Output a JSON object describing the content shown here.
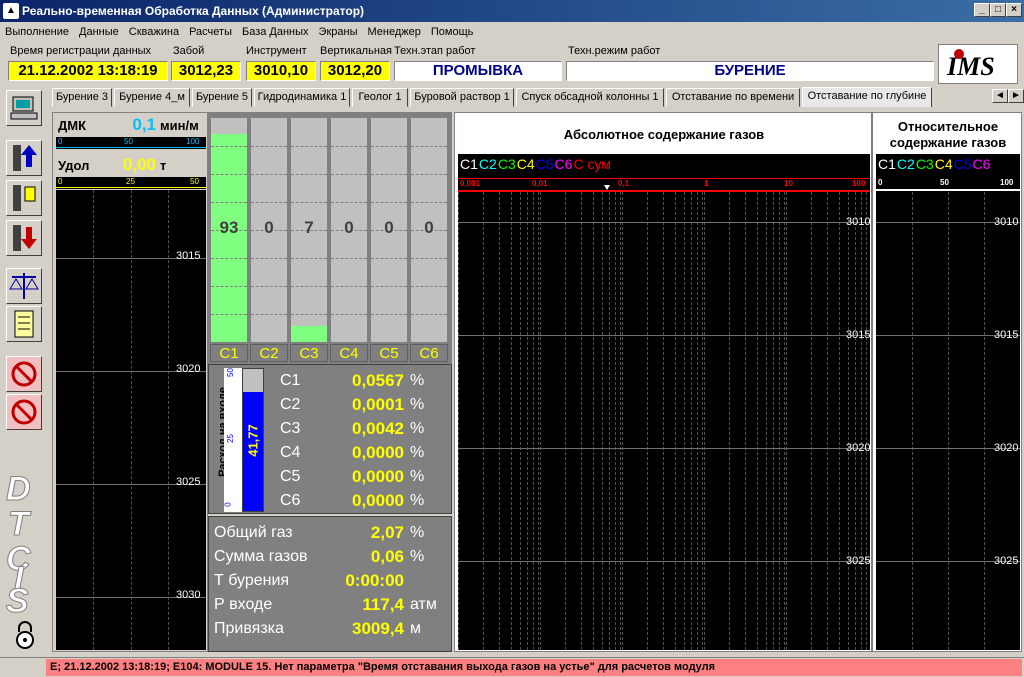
{
  "window": {
    "title": "Реально-временная Обработка Данных (Администратор)"
  },
  "menu": [
    "Выполнение",
    "Данные",
    "Скважина",
    "Расчеты",
    "База Данных",
    "Экраны",
    "Менеджер",
    "Помощь"
  ],
  "header": {
    "reg_time_label": "Время регистрации данных",
    "reg_time_value": "21.12.2002 13:18:19",
    "bottom_label": "Забой",
    "bottom_value": "3012,23",
    "tool_label": "Инструмент",
    "tool_value": "3010,10",
    "vertical_label": "Вертикальная",
    "vertical_value": "3012,20",
    "stage_label": "Техн.этап работ",
    "stage_value": "ПРОМЫВКА",
    "mode_label": "Техн.режим работ",
    "mode_value": "БУРЕНИЕ"
  },
  "tabs": [
    "Бурение 3",
    "Бурение 4_м",
    "Бурение 5",
    "Гидродинамика 1",
    "Геолог 1",
    "Буровой раствор 1",
    "Спуск обсадной колонны 1",
    "Отставание по времени",
    "Отставание по глубине"
  ],
  "active_tab": 8,
  "left_panel": {
    "dmk_label": "ДМК",
    "dmk_value": "0,1",
    "dmk_unit": "мин/м",
    "dmk_scale": [
      "0",
      "50",
      "100"
    ],
    "udol_label": "Удол",
    "udol_value": "0,00",
    "udol_unit": "т",
    "udol_scale": [
      "0",
      "25",
      "50"
    ],
    "depths": [
      "3015",
      "3020",
      "3025",
      "3030"
    ]
  },
  "gas_columns": {
    "names": [
      "C1",
      "C2",
      "C3",
      "C4",
      "C5",
      "C6"
    ],
    "values": [
      "93",
      "0",
      "7",
      "0",
      "0",
      "0"
    ],
    "fill_percent": [
      93,
      0,
      7,
      0,
      0,
      0
    ]
  },
  "flow": {
    "label": "Расход на входе",
    "value": "41,77",
    "scale": [
      "50",
      "25",
      "0"
    ],
    "fill_percent": 84
  },
  "gas_content": [
    {
      "name": "C1",
      "value": "0,0567",
      "unit": "%"
    },
    {
      "name": "C2",
      "value": "0,0001",
      "unit": "%"
    },
    {
      "name": "C3",
      "value": "0,0042",
      "unit": "%"
    },
    {
      "name": "C4",
      "value": "0,0000",
      "unit": "%"
    },
    {
      "name": "C5",
      "value": "0,0000",
      "unit": "%"
    },
    {
      "name": "C6",
      "value": "0,0000",
      "unit": "%"
    }
  ],
  "summary": [
    {
      "label": "Общий газ",
      "value": "2,07",
      "unit": "%"
    },
    {
      "label": "Сумма газов",
      "value": "0,06",
      "unit": "%"
    },
    {
      "label": "Т бурения",
      "value": "0:00:00",
      "unit": ""
    },
    {
      "label": "Р входе",
      "value": "117,4",
      "unit": "атм"
    },
    {
      "label": "Привязка",
      "value": "3009,4",
      "unit": "м"
    }
  ],
  "abs_panel": {
    "title": "Абсолютное содержание газов",
    "legend": [
      {
        "text": "C1",
        "color": "#ffffff"
      },
      {
        "text": "C2",
        "color": "#00ffff"
      },
      {
        "text": "C3",
        "color": "#00ff00"
      },
      {
        "text": "C4",
        "color": "#ffff00"
      },
      {
        "text": "C5",
        "color": "#0000ff"
      },
      {
        "text": "C6",
        "color": "#ff00ff"
      },
      {
        "text": "C сум",
        "color": "#ff0000"
      }
    ],
    "scale": [
      "0,001",
      "0,01",
      "0,1",
      "1",
      "10",
      "100"
    ],
    "depths": [
      "3010",
      "3015",
      "3020",
      "3025"
    ]
  },
  "rel_panel": {
    "title_line1": "Относительное",
    "title_line2": "содержание газов",
    "legend": [
      {
        "text": "C1",
        "color": "#ffffff"
      },
      {
        "text": "C2",
        "color": "#00ffff"
      },
      {
        "text": "C3",
        "color": "#00ff00"
      },
      {
        "text": "C4",
        "color": "#ffff00"
      },
      {
        "text": "C5",
        "color": "#0000ff"
      },
      {
        "text": "C6",
        "color": "#ff00ff"
      }
    ],
    "scale": [
      "0",
      "50",
      "100"
    ],
    "depths": [
      "3010",
      "3015",
      "3020",
      "3025"
    ]
  },
  "brand": "DTCIS",
  "status": {
    "message": "E; 21.12.2002 13:18:19; E104: MODULE 15. Нет параметра  \"Время отставания выхода газов на устье\" для расчетов модуля"
  }
}
